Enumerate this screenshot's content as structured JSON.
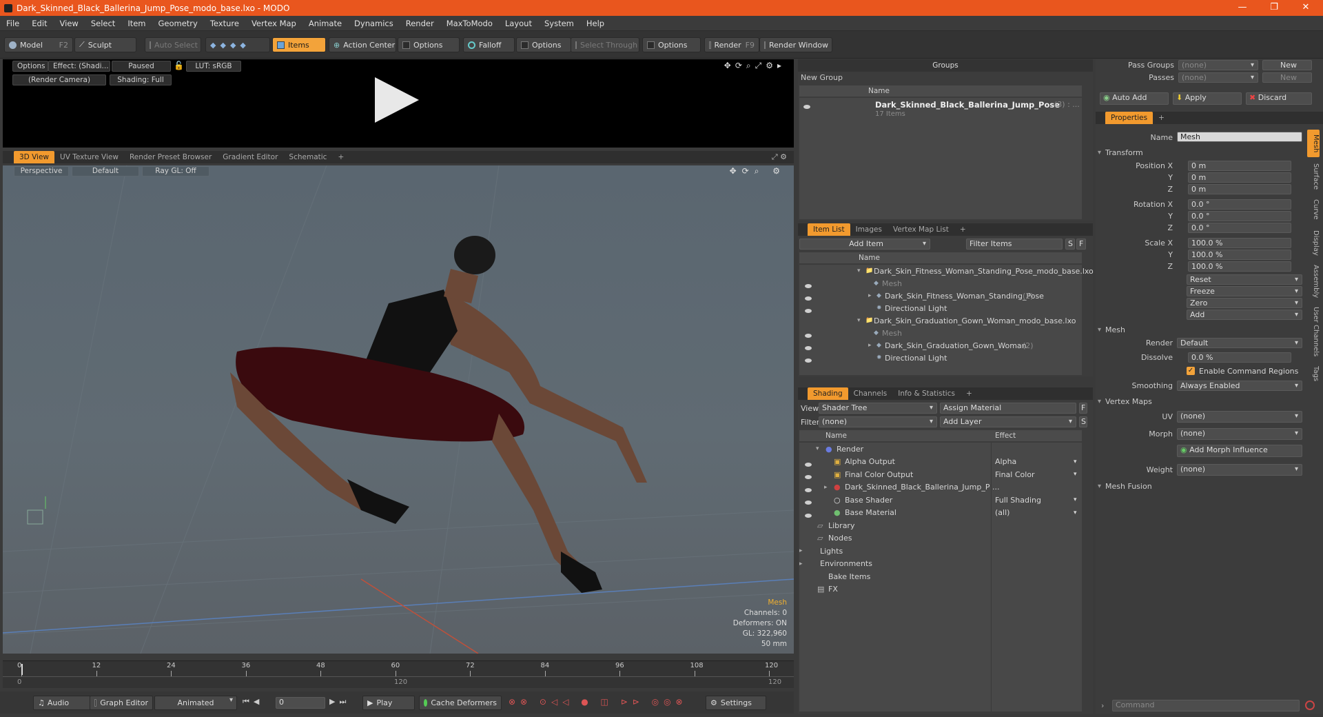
{
  "window": {
    "title": "Dark_Skinned_Black_Ballerina_Jump_Pose_modo_base.lxo - MODO",
    "minimize": "—",
    "maximize": "❐",
    "close": "✕"
  },
  "menu": [
    "File",
    "Edit",
    "View",
    "Select",
    "Item",
    "Geometry",
    "Texture",
    "Vertex Map",
    "Animate",
    "Dynamics",
    "Render",
    "MaxToModo",
    "Layout",
    "System",
    "Help"
  ],
  "toolbar": {
    "model": "Model",
    "model_key": "F2",
    "sculpt": "Sculpt",
    "auto_select": "Auto Select",
    "items": "Items",
    "action_center": "Action Center",
    "options1": "Options",
    "falloff": "Falloff",
    "options2": "Options",
    "select_through": "Select Through",
    "options3": "Options",
    "render": "Render",
    "render_key": "F9",
    "render_window": "Render Window"
  },
  "preview": {
    "options": "Options",
    "effect": "Effect: (Shadi...",
    "paused": "Paused",
    "lut": "LUT: sRGB",
    "camera": "(Render Camera)",
    "shading": "Shading: Full"
  },
  "viewport_tabs": [
    "3D View",
    "UV Texture View",
    "Render Preset Browser",
    "Gradient Editor",
    "Schematic",
    "+"
  ],
  "viewport": {
    "perspective": "Perspective",
    "default": "Default",
    "raygl": "Ray GL: Off",
    "stats": {
      "label": "Mesh",
      "channels": "Channels: 0",
      "deformers": "Deformers: ON",
      "gl": "GL: 322,960",
      "focal": "50 mm"
    }
  },
  "timeline": {
    "ticks": [
      "0",
      "12",
      "24",
      "36",
      "48",
      "60",
      "72",
      "84",
      "96",
      "108",
      "120"
    ],
    "sub_ticks": [
      "0",
      "120",
      "120"
    ]
  },
  "bottom": {
    "audio": "Audio",
    "graph_editor": "Graph Editor",
    "animated": "Animated",
    "frame": "0",
    "play": "Play",
    "cache": "Cache Deformers",
    "settings": "Settings"
  },
  "groups": {
    "title": "Groups",
    "new_group": "New Group",
    "col_name": "Name",
    "item_name": "Dark_Skinned_Black_Ballerina_Jump_Pose",
    "item_count": "(3) : ...",
    "item_sub": "17 Items"
  },
  "itemlist": {
    "tabs": [
      "Item List",
      "Images",
      "Vertex Map List",
      "+"
    ],
    "add_item": "Add Item",
    "filter": "Filter Items",
    "s": "S",
    "f": "F",
    "col_name": "Name",
    "rows": [
      {
        "label": "Dark_Skin_Fitness_Woman_Standing_Pose_modo_base.lxo",
        "extra": ""
      },
      {
        "label": "Mesh",
        "extra": ""
      },
      {
        "label": "Dark_Skin_Fitness_Woman_Standing_Pose",
        "extra": "(2)"
      },
      {
        "label": "Directional Light",
        "extra": ""
      },
      {
        "label": "Dark_Skin_Graduation_Gown_Woman_modo_base.lxo",
        "extra": ""
      },
      {
        "label": "Mesh",
        "extra": ""
      },
      {
        "label": "Dark_Skin_Graduation_Gown_Woman",
        "extra": "(2)"
      },
      {
        "label": "Directional Light",
        "extra": ""
      }
    ]
  },
  "shading": {
    "tabs": [
      "Shading",
      "Channels",
      "Info & Statistics",
      "+"
    ],
    "view_label": "View",
    "view_value": "Shader Tree",
    "assign": "Assign Material",
    "f": "F",
    "filter_label": "Filter",
    "filter_value": "(none)",
    "add_layer": "Add Layer",
    "s": "S",
    "col_name": "Name",
    "col_effect": "Effect",
    "rows": [
      {
        "name": "Render",
        "effect": ""
      },
      {
        "name": "Alpha Output",
        "effect": "Alpha"
      },
      {
        "name": "Final Color Output",
        "effect": "Final Color"
      },
      {
        "name": "Dark_Skinned_Black_Ballerina_Jump_P ...",
        "effect": ""
      },
      {
        "name": "Base Shader",
        "effect": "Full Shading"
      },
      {
        "name": "Base Material",
        "effect": "(all)"
      },
      {
        "name": "Library",
        "effect": ""
      },
      {
        "name": "Nodes",
        "effect": ""
      },
      {
        "name": "Lights",
        "effect": ""
      },
      {
        "name": "Environments",
        "effect": ""
      },
      {
        "name": "Bake Items",
        "effect": ""
      },
      {
        "name": "FX",
        "effect": ""
      }
    ]
  },
  "right": {
    "pass_groups": "Pass Groups",
    "passes": "Passes",
    "none": "(none)",
    "new": "New",
    "auto_add": "Auto Add",
    "apply": "Apply",
    "discard": "Discard",
    "properties": "Properties",
    "plus": "+",
    "name_label": "Name",
    "name_value": "Mesh",
    "transform": "Transform",
    "pos_x": "Position X",
    "y": "Y",
    "z": "Z",
    "pos_vals": [
      "0 m",
      "0 m",
      "0 m"
    ],
    "rot_x": "Rotation X",
    "rot_vals": [
      "0.0 °",
      "0.0 °",
      "0.0 °"
    ],
    "scale_x": "Scale X",
    "scale_vals": [
      "100.0 %",
      "100.0 %",
      "100.0 %"
    ],
    "actions": [
      "Reset",
      "Freeze",
      "Zero",
      "Add"
    ],
    "mesh": "Mesh",
    "render_label": "Render",
    "render_value": "Default",
    "dissolve_label": "Dissolve",
    "dissolve_value": "0.0 %",
    "enable_cmd": "Enable Command Regions",
    "smoothing_label": "Smoothing",
    "smoothing_value": "Always Enabled",
    "vertex_maps": "Vertex Maps",
    "uv_label": "UV",
    "uv_value": "(none)",
    "morph_label": "Morph",
    "morph_value": "(none)",
    "add_morph": "Add Morph Influence",
    "weight_label": "Weight",
    "weight_value": "(none)",
    "mesh_fusion": "Mesh Fusion",
    "command": "Command",
    "side_tabs": [
      "Mesh",
      "Surface",
      "Curve",
      "Display",
      "Assembly",
      "User Channels",
      "Tags"
    ]
  },
  "colors": {
    "accent": "#f29a2e",
    "title": "#e9561e"
  }
}
